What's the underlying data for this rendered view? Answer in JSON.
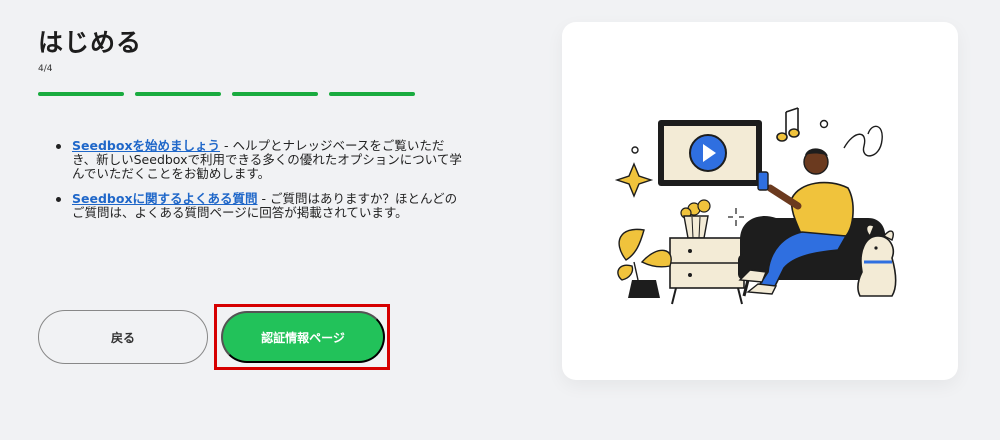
{
  "header": {
    "title": "はじめる",
    "step_count": "4/4",
    "progress": {
      "current": 4,
      "total": 4
    }
  },
  "bullets": [
    {
      "link": "Seedboxを始めましょう",
      "text": " - ヘルプとナレッジベースをご覧いただき、新しいSeedboxで利用できる多くの優れたオプションについて学んでいただくことをお勧めします。"
    },
    {
      "link": "Seedboxに関するよくある質問",
      "text": " - ご質問はありますか？ほとんどのご質問は、よくある質問ページに回答が掲載されています。"
    }
  ],
  "buttons": {
    "back_label": "戻る",
    "primary_label": "認証情報ページ"
  },
  "colors": {
    "accent_green": "#22c25a",
    "progress_green": "#1aab3f",
    "link_blue": "#1f67c9",
    "highlight_red": "#d60000"
  },
  "illustration": {
    "icons": [
      "tv-play-icon",
      "music-note-icon",
      "sparkle-icon",
      "popcorn-icon",
      "plant-icon",
      "dog-icon",
      "phone-icon"
    ]
  }
}
